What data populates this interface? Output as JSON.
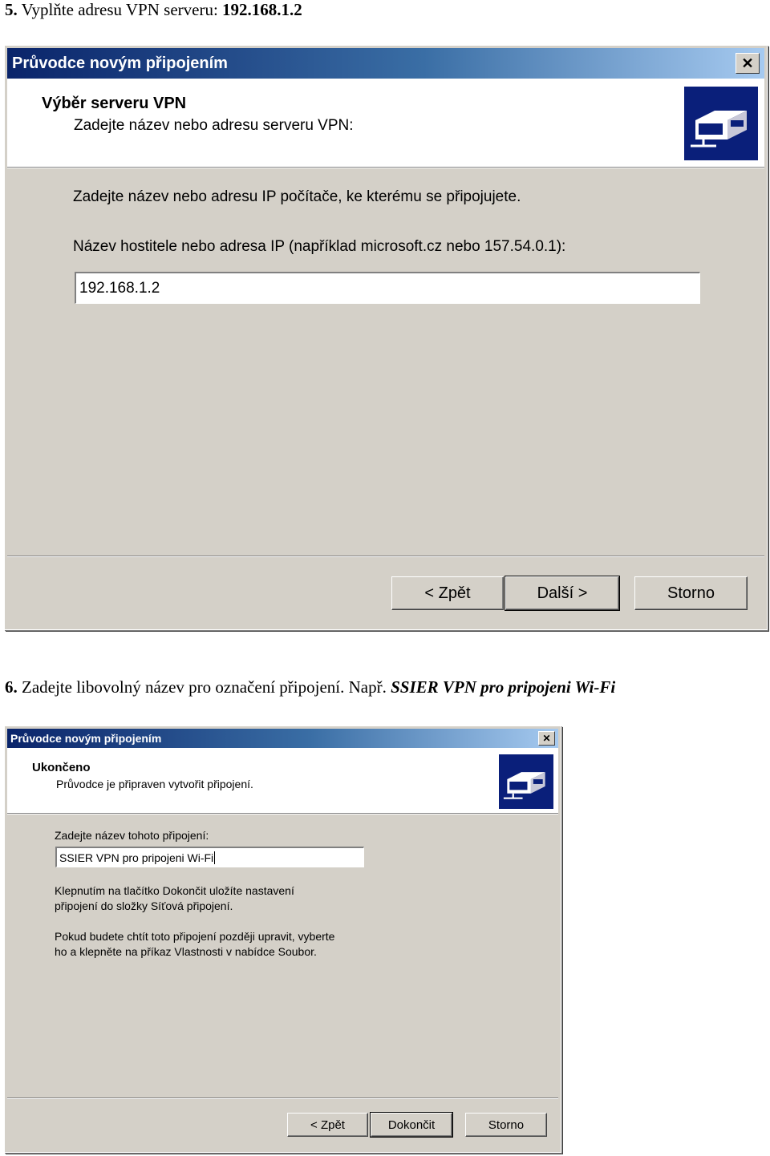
{
  "step5": {
    "number": "5.",
    "text": "Vyplňte adresu VPN serveru:",
    "value": "192.168.1.2"
  },
  "dialog1": {
    "title": "Průvodce novým připojením",
    "close_label": "✕",
    "header_title": "Výběr serveru VPN",
    "header_subtitle": "Zadejte název nebo adresu serveru VPN:",
    "instruction": "Zadejte název nebo adresu IP počítače, ke kterému se připojujete.",
    "field_label": "Název hostitele nebo adresa IP (například microsoft.cz nebo 157.54.0.1):",
    "field_value": "192.168.1.2",
    "back_label": "< Zpět",
    "next_label": "Další >",
    "cancel_label": "Storno"
  },
  "step6": {
    "number": "6.",
    "text": "Zadejte libovolný název pro označení připojení. Např.",
    "example": "SSIER VPN pro pripojeni Wi-Fi"
  },
  "dialog2": {
    "title": "Průvodce novým připojením",
    "close_label": "✕",
    "header_title": "Ukončeno",
    "header_subtitle": "Průvodce je připraven vytvořit připojení.",
    "field_label": "Zadejte název tohoto připojení:",
    "field_value": "SSIER VPN pro pripojeni Wi-Fi",
    "info1_line1": "Klepnutím na tlačítko Dokončit uložíte nastavení",
    "info1_line2": "připojení do složky Síťová připojení.",
    "info2_line1": "Pokud budete chtít toto připojení později upravit, vyberte",
    "info2_line2": "ho a klepněte na příkaz Vlastnosti v nabídce Soubor.",
    "back_label": "< Zpět",
    "finish_label": "Dokončit",
    "cancel_label": "Storno"
  },
  "icons": {
    "wizard_logo": "network-connection-icon",
    "close": "close-icon"
  },
  "colors": {
    "titlebar_start": "#0a246a",
    "titlebar_end": "#a6caf0",
    "dialog_face": "#d4d0c8",
    "logo_bg": "#0a1f7a"
  }
}
